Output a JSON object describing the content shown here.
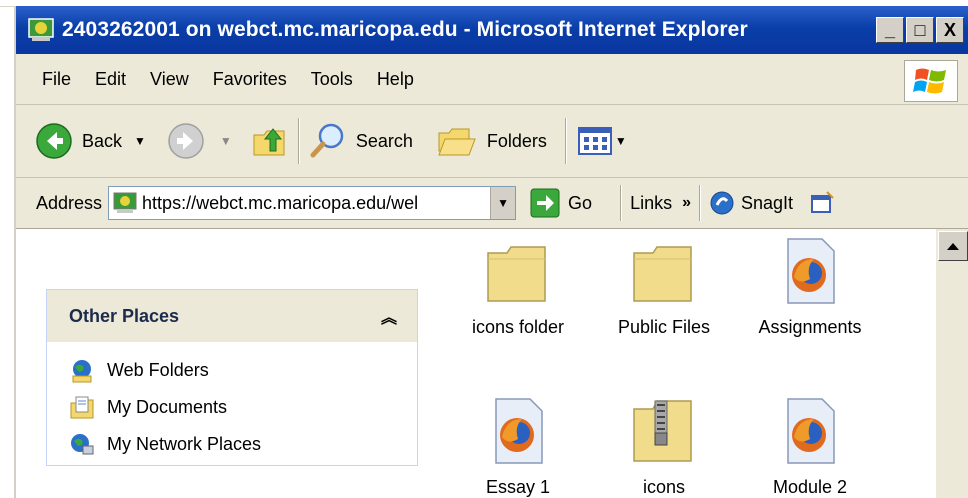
{
  "window": {
    "title": "2403262001 on webct.mc.maricopa.edu - Microsoft Internet Explorer",
    "buttons": {
      "minimize": "_",
      "maximize": "□",
      "close": "X"
    }
  },
  "menu": [
    "File",
    "Edit",
    "View",
    "Favorites",
    "Tools",
    "Help"
  ],
  "toolbar": {
    "back_label": "Back",
    "search_label": "Search",
    "folders_label": "Folders"
  },
  "address": {
    "label": "Address",
    "value": "https://webct.mc.maricopa.edu/wel",
    "go_label": "Go",
    "links_label": "Links",
    "snagit_label": "SnagIt"
  },
  "sidebar": {
    "title": "Other Places",
    "items": [
      {
        "label": "Web Folders",
        "icon": "web-folders-icon"
      },
      {
        "label": "My Documents",
        "icon": "my-documents-icon"
      },
      {
        "label": "My Network Places",
        "icon": "network-places-icon"
      }
    ]
  },
  "files": [
    {
      "label": "icons folder",
      "type": "folder"
    },
    {
      "label": "Public Files",
      "type": "folder"
    },
    {
      "label": "Assignments",
      "type": "firefox-doc"
    },
    {
      "label": "Essay 1",
      "type": "firefox-doc"
    },
    {
      "label": "icons",
      "type": "zip-folder"
    },
    {
      "label": "Module 2",
      "type": "firefox-doc"
    }
  ],
  "colors": {
    "titlebar": "#0a3ea8",
    "chrome": "#ece9d8",
    "panel_border": "#c6d3f7"
  }
}
